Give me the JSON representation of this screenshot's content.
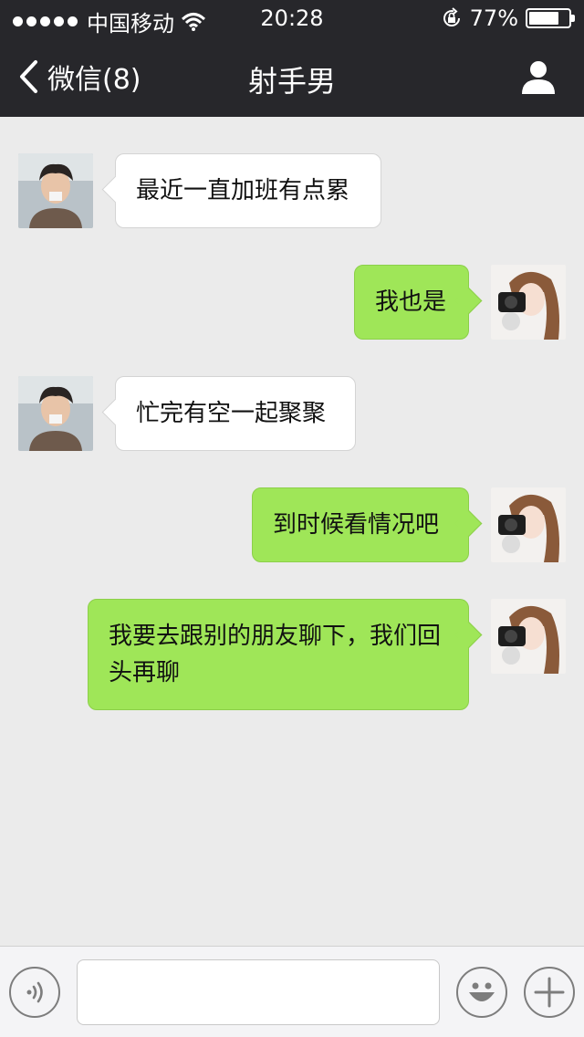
{
  "status_bar": {
    "carrier": "中国移动",
    "time": "20:28",
    "battery_percent": "77%",
    "battery_level": 0.77
  },
  "nav": {
    "back_label": "微信(8)",
    "title": "射手男"
  },
  "messages": [
    {
      "side": "in",
      "text": "最近一直加班有点累"
    },
    {
      "side": "out",
      "text": "我也是"
    },
    {
      "side": "in",
      "text": "忙完有空一起聚聚"
    },
    {
      "side": "out",
      "text": "到时候看情况吧"
    },
    {
      "side": "out",
      "text": "我要去跟别的朋友聊下，我们回头再聊"
    }
  ],
  "input": {
    "value": "",
    "placeholder": ""
  },
  "icons": {
    "back": "chevron-left-icon",
    "profile": "person-icon",
    "voice": "voice-icon",
    "emoji": "emoji-icon",
    "plus": "plus-icon"
  },
  "colors": {
    "nav_bg": "#27272b",
    "chat_bg": "#ebebeb",
    "outgoing_bubble": "#9fe658",
    "incoming_bubble": "#ffffff"
  }
}
